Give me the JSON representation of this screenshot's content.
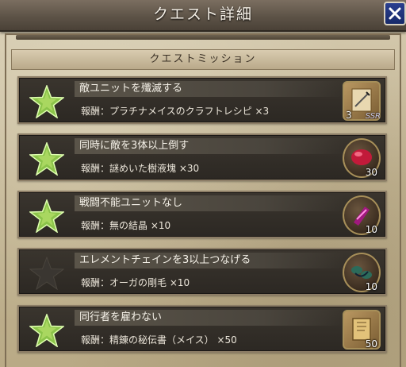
{
  "header": {
    "title": "クエスト詳細"
  },
  "section": {
    "label": "クエストミッション"
  },
  "missions": [
    {
      "title": "敵ユニットを殲滅する",
      "reward": "報酬：プラチナメイスのクラフトレシピ ×3",
      "item_count": "3",
      "rarity": "SSR",
      "achieved": true,
      "item_icon": "scroll-icon"
    },
    {
      "title": "同時に敵を3体以上倒す",
      "reward": "報酬：謎めいた樹液塊 ×30",
      "item_count": "30",
      "achieved": true,
      "item_icon": "sap-icon"
    },
    {
      "title": "戦闘不能ユニットなし",
      "reward": "報酬：無の結晶 ×10",
      "item_count": "10",
      "achieved": true,
      "item_icon": "crystal-icon"
    },
    {
      "title": "エレメントチェインを3以上つなげる",
      "reward": "報酬：オーガの剛毛 ×10",
      "item_count": "10",
      "achieved": false,
      "item_icon": "bristle-icon"
    },
    {
      "title": "同行者を雇わない",
      "reward": "報酬：精錬の秘伝書（メイス） ×50",
      "item_count": "50",
      "achieved": true,
      "item_icon": "book-icon"
    }
  ],
  "colors": {
    "star_achieved": "#8bc34a",
    "star_unachieved": "#3a3631",
    "close_button": "#1f3380"
  }
}
